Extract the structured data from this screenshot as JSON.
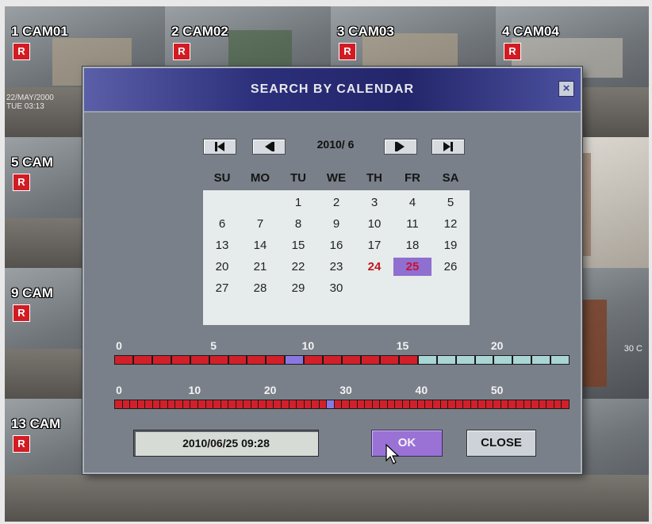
{
  "cameras": [
    {
      "label": "1 CAM01",
      "badge": "R"
    },
    {
      "label": "2 CAM02",
      "badge": "R"
    },
    {
      "label": "3 CAM03",
      "badge": "R"
    },
    {
      "label": "4 CAM04",
      "badge": "R"
    },
    {
      "label": "5 CAM",
      "badge": "R"
    },
    {
      "label": "9 CAM",
      "badge": "R"
    },
    {
      "label": "13 CAM",
      "badge": "R"
    }
  ],
  "camera_timestamp": "22/MAY/2000\nTUE 03:13",
  "camera_side_text": "30 C",
  "dialog": {
    "title": "SEARCH BY CALENDAR",
    "close_icon": "×",
    "month_label": "2010/ 6",
    "weekdays": [
      "SU",
      "MO",
      "TU",
      "WE",
      "TH",
      "FR",
      "SA"
    ],
    "first_weekday_index": 2,
    "days_in_month": 30,
    "recorded_days": [
      24,
      25
    ],
    "selected_day": 25,
    "hour_timeline": {
      "labels": [
        "0",
        "5",
        "10",
        "15",
        "20"
      ],
      "segments": 24,
      "recorded_until_hour": 16,
      "current_hour": 9
    },
    "minute_timeline": {
      "labels": [
        "0",
        "10",
        "20",
        "30",
        "40",
        "50"
      ],
      "segments": 60,
      "current_minute": 28
    },
    "datetime_value": "2010/06/25 09:28",
    "ok_label": "OK",
    "close_label": "CLOSE"
  },
  "colors": {
    "recorded": "#d2202a",
    "current": "#8a78e0",
    "empty": "#a9d5d4",
    "accent": "#9a72d6"
  }
}
